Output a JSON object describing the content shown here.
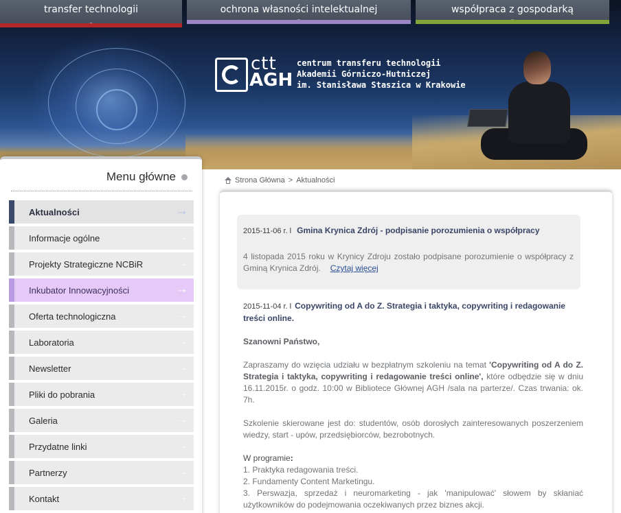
{
  "top_nav": [
    {
      "label": "transfer technologii",
      "accent": "#b3262a"
    },
    {
      "label": "ochrona własności intelektualnej",
      "accent": "#9a86c4"
    },
    {
      "label": "współpraca z gospodarką",
      "accent": "#7fa636"
    }
  ],
  "logo": {
    "ctt": "ctt",
    "agh": "AGH",
    "lines": [
      "centrum transferu technologii",
      "Akademii Górniczo-Hutniczej",
      "im. Stanisława Staszica w Krakowie"
    ]
  },
  "sidebar": {
    "title": "Menu główne",
    "items": [
      {
        "label": "Aktualności",
        "state": "active"
      },
      {
        "label": "Informacje ogólne",
        "state": "normal"
      },
      {
        "label": "Projekty Strategiczne NCBiR",
        "state": "normal"
      },
      {
        "label": "Inkubator Innowacyjności",
        "state": "hover"
      },
      {
        "label": "Oferta technologiczna",
        "state": "normal"
      },
      {
        "label": "Laboratoria",
        "state": "normal"
      },
      {
        "label": "Newsletter",
        "state": "normal"
      },
      {
        "label": "Pliki do pobrania",
        "state": "normal"
      },
      {
        "label": "Galeria",
        "state": "normal"
      },
      {
        "label": "Przydatne linki",
        "state": "normal"
      },
      {
        "label": "Partnerzy",
        "state": "normal"
      },
      {
        "label": "Kontakt",
        "state": "normal"
      }
    ]
  },
  "breadcrumb": {
    "home": "Strona Główna",
    "separator": ">",
    "current": "Aktualności"
  },
  "news": [
    {
      "date": "2015-11-06 r. l",
      "title": "Gmina Krynica Zdrój - podpisanie porozumienia o współpracy",
      "body": "4 listopada 2015 roku w Krynicy Zdroju zostało podpisane porozumienie o współpracy z Gminą Krynica Zdrój.",
      "read_more": "Czytaj więcej"
    },
    {
      "date": "2015-11-04 r. l",
      "title": "Copywriting od A do Z. Strategia i taktyka, copywriting i redagowanie treści online.",
      "greeting": "Szanowni Państwo,",
      "p1_before": "Zapraszamy do wzięcia udziału w bezpłatnym szkoleniu na temat ",
      "p1_bold": "'Copywriting od A do Z. Strategia i taktyka, copywriting i redagowanie treści online',",
      "p1_after": " które odbędzie się w dniu 16.11.2015r. o godz. 10:00 w Bibliotece Głównej AGH /sala na parterze/. Czas trwania: ok. 7h.",
      "p2": "Szkolenie skierowane jest do: studentów, osób dorosłych zainteresowanych poszerzeniem wiedzy, start - upów, przedsiębiorców, bezrobotnych.",
      "program_label": "W programie",
      "program_colon": ":",
      "program": [
        "1. Praktyka redagowania treści.",
        "2. Fundamenty Content Marketingu.",
        "3. Perswazja, sprzedaż i neuromarketing - jak 'manipulować' słowem by skłaniać użytkowników do podejmowania oczekiwanych przez biznes akcji."
      ]
    }
  ]
}
